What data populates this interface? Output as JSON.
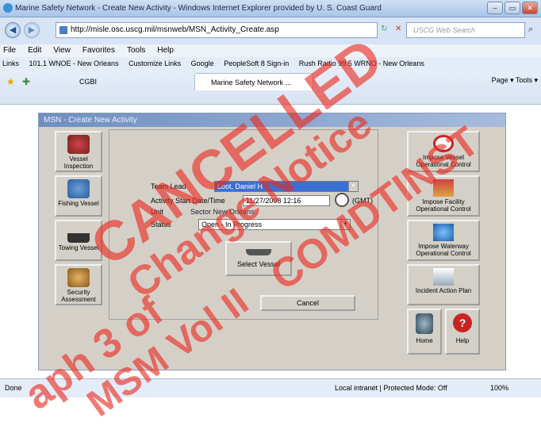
{
  "window": {
    "title": "Marine Safety Network - Create New Activity - Windows Internet Explorer provided by U. S. Coast Guard",
    "min": "–",
    "max": "▭",
    "close": "✕"
  },
  "address": {
    "url": "http://misle.osc.uscg.mil/msnweb/MSN_Activity_Create.asp",
    "refresh": "↻",
    "stop": "✕",
    "search_placeholder": "USCG Web Search",
    "search_icon": "⌕"
  },
  "menu": [
    "File",
    "Edit",
    "View",
    "Favorites",
    "Tools",
    "Help"
  ],
  "links": [
    "Links",
    "101.1 WNOE - New Orleans",
    "Customize Links",
    "Google",
    "PeopleSoft 8 Sign-in",
    "Rush Radio 99.5 WRNO - New Orleans"
  ],
  "tabs": {
    "first": "CGBI",
    "second": "Marine Safety Network ...",
    "tools": "Page ▾   Tools ▾"
  },
  "app": {
    "title": "MSN - Create New Activity",
    "left_tiles": [
      "Vessel Inspection",
      "Fishing Vessel",
      "Towing Vessel",
      "Security Assessment"
    ],
    "right_tiles": [
      "Impose Vessel Operational Control",
      "Impose Facility Operational Control",
      "Impose Waterway Operational Control",
      "Incident Action Plan"
    ],
    "home": "Home",
    "help": "Help",
    "help_glyph": "?"
  },
  "form": {
    "team_lead_label": "Team Lead",
    "team_lead_value": "Loot, Daniel H",
    "start_label": "Activity Start Date/Time",
    "start_value": "11/27/2008 12:16",
    "tz": "(GMT)",
    "unit_label": "Unit",
    "unit_value": "Sector New Orleans",
    "status_label": "Status",
    "status_value": "Open - In Progress",
    "select_vessel": "Select Vessel",
    "cancel": "Cancel",
    "dropdown_glyph": "▾"
  },
  "statusbar": {
    "left": "Done",
    "zone": "Local intranet | Protected Mode: Off",
    "zoom": "100%"
  },
  "watermark": [
    "CANCELLED",
    "Change Notice",
    "COMDTINST",
    "aph 3 of",
    "MSM Vol II"
  ]
}
